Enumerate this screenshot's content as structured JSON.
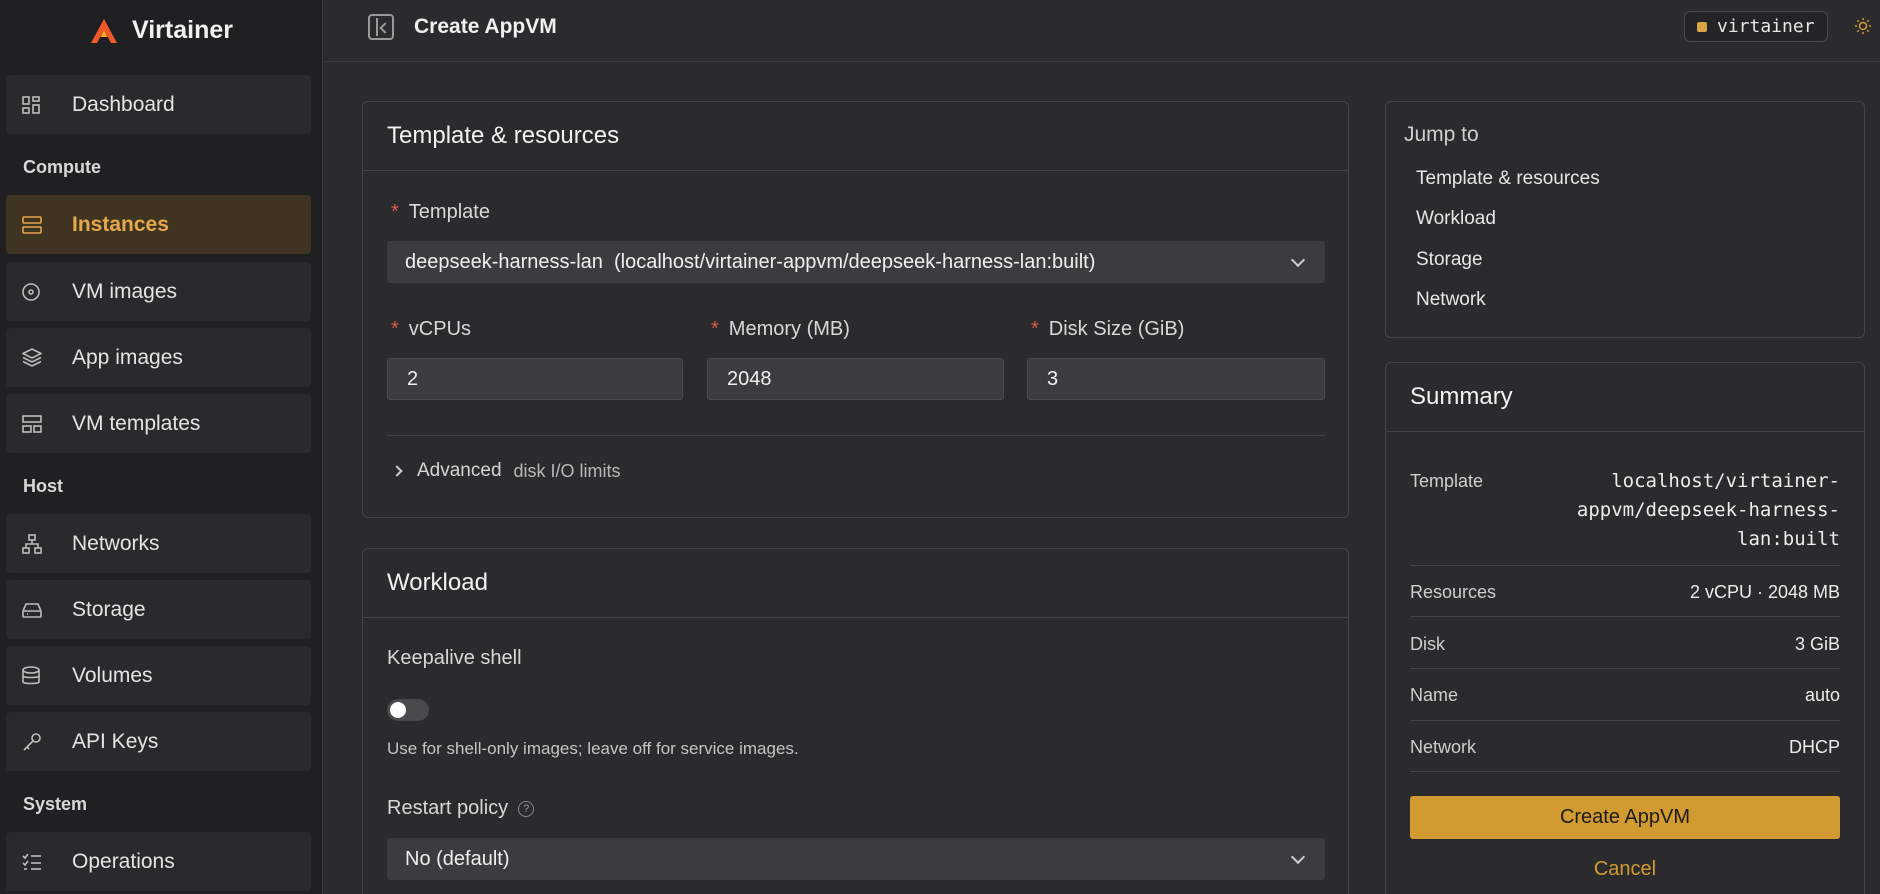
{
  "app": {
    "name": "Virtainer"
  },
  "sidebar": {
    "items": [
      {
        "label": "Dashboard",
        "icon": "dashboard-icon"
      },
      {
        "label": "Instances",
        "icon": "server-icon",
        "active": true
      },
      {
        "label": "VM images",
        "icon": "disc-icon"
      },
      {
        "label": "App images",
        "icon": "package-icon"
      },
      {
        "label": "VM templates",
        "icon": "template-icon"
      },
      {
        "label": "Networks",
        "icon": "network-icon"
      },
      {
        "label": "Storage",
        "icon": "drive-icon"
      },
      {
        "label": "Volumes",
        "icon": "database-icon"
      },
      {
        "label": "API Keys",
        "icon": "key-icon"
      },
      {
        "label": "Operations",
        "icon": "list-check-icon"
      }
    ],
    "sections": {
      "compute": "Compute",
      "host": "Host",
      "system": "System"
    }
  },
  "header": {
    "title": "Create AppVM",
    "user": "virtainer"
  },
  "form": {
    "template_card": {
      "title": "Template & resources",
      "template_label": "Template",
      "template_value": "deepseek-harness-lan  (localhost/virtainer-appvm/deepseek-harness-lan:built)",
      "vcpus_label": "vCPUs",
      "vcpus_value": "2",
      "memory_label": "Memory (MB)",
      "memory_value": "2048",
      "disk_label": "Disk Size (GiB)",
      "disk_value": "3",
      "advanced_label": "Advanced",
      "advanced_sub": "disk I/O limits"
    },
    "workload_card": {
      "title": "Workload",
      "keepalive_label": "Keepalive shell",
      "keepalive_on": false,
      "keepalive_help": "Use for shell-only images; leave off for service images.",
      "restart_label": "Restart policy",
      "restart_value": "No (default)"
    }
  },
  "jump": {
    "title": "Jump to",
    "links": [
      "Template & resources",
      "Workload",
      "Storage",
      "Network"
    ]
  },
  "summary": {
    "title": "Summary",
    "rows": [
      {
        "key": "Template",
        "value": "localhost/virtainer-appvm/deepseek-harness-lan:built"
      },
      {
        "key": "Resources",
        "value": "2 vCPU · 2048 MB"
      },
      {
        "key": "Disk",
        "value": "3 GiB"
      },
      {
        "key": "Name",
        "value": "auto"
      },
      {
        "key": "Network",
        "value": "DHCP"
      }
    ],
    "create_label": "Create AppVM",
    "cancel_label": "Cancel"
  },
  "colors": {
    "accent": "#d29b31",
    "active_text": "#e6a84a",
    "required": "#e05a4a"
  }
}
